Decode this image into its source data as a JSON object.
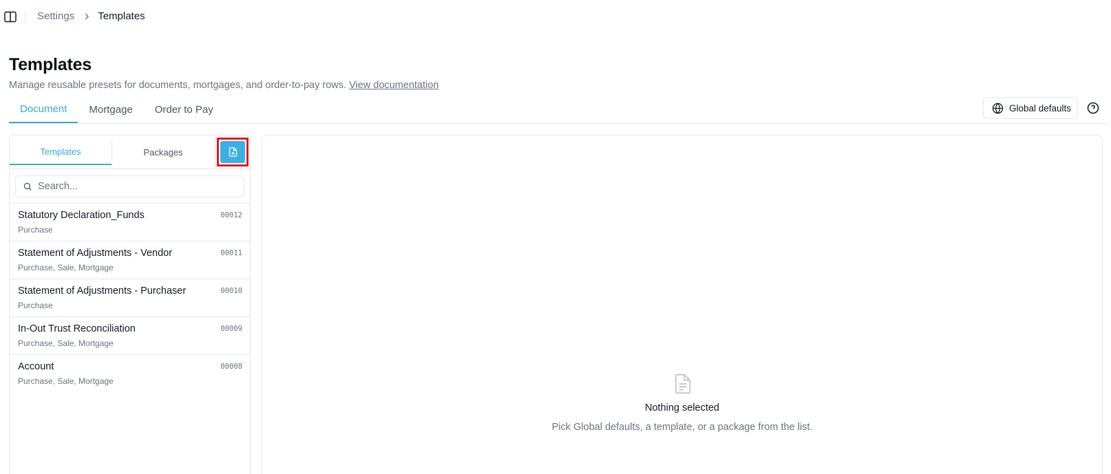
{
  "breadcrumb": {
    "parent": "Settings",
    "current": "Templates"
  },
  "header": {
    "title": "Templates",
    "subtitle": "Manage reusable presets for documents, mortgages, and order-to-pay rows.",
    "doc_link": "View documentation"
  },
  "main_tabs": [
    {
      "label": "Document",
      "active": true
    },
    {
      "label": "Mortgage",
      "active": false
    },
    {
      "label": "Order to Pay",
      "active": false
    }
  ],
  "toolbar": {
    "global_defaults_label": "Global defaults",
    "globe_icon": "globe-icon",
    "help_icon": "help-circle-icon"
  },
  "left_panel": {
    "sub_tabs": [
      {
        "label": "Templates",
        "active": true
      },
      {
        "label": "Packages",
        "active": false
      }
    ],
    "new_template_icon": "file-plus-icon",
    "search": {
      "placeholder": "Search...",
      "value": ""
    },
    "templates": [
      {
        "name": "Statutory Declaration_Funds",
        "tags": "Purchase",
        "code": "00012"
      },
      {
        "name": "Statement of Adjustments - Vendor",
        "tags": "Purchase, Sale, Mortgage",
        "code": "00011"
      },
      {
        "name": "Statement of Adjustments - Purchaser",
        "tags": "Purchase",
        "code": "00010"
      },
      {
        "name": "In-Out Trust Reconciliation",
        "tags": "Purchase, Sale, Mortgage",
        "code": "00009"
      },
      {
        "name": "Account",
        "tags": "Purchase, Sale, Mortgage",
        "code": "00008"
      }
    ]
  },
  "empty_state": {
    "icon": "file-text-icon",
    "title": "Nothing selected",
    "description": "Pick Global defaults, a template, or a package from the list."
  },
  "colors": {
    "accent": "#38a8d9",
    "accent_button": "#3cb0e2",
    "highlight_border": "#e1191a",
    "border": "#e5e7eb",
    "muted_text": "#6b7280"
  }
}
